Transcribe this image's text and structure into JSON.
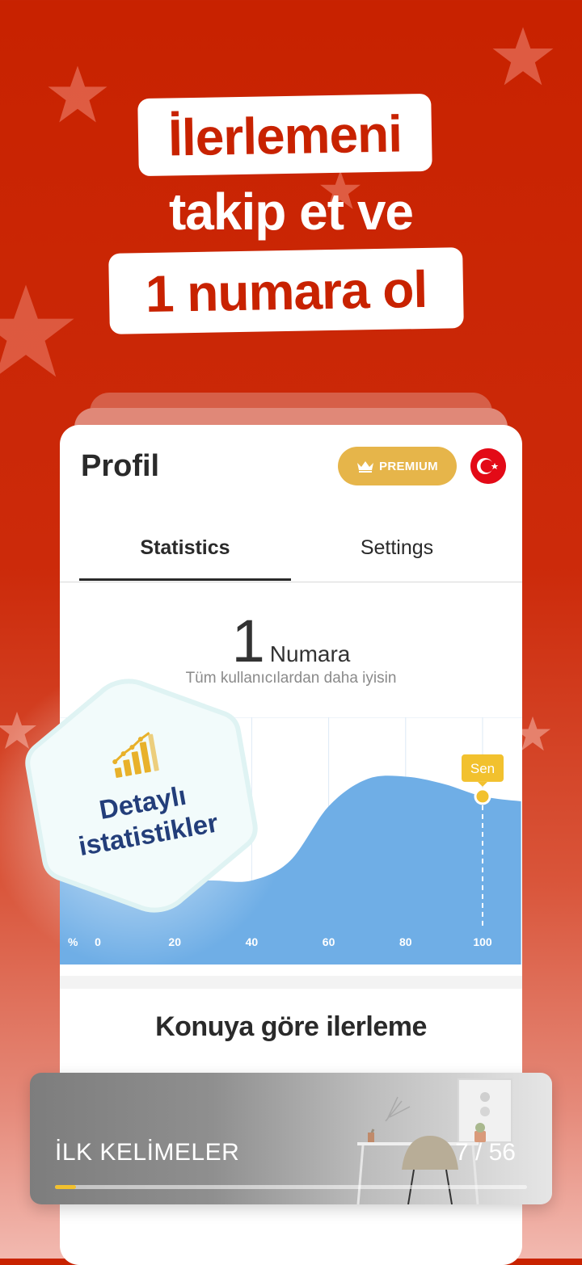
{
  "headline": {
    "line1": "İlerlemeni",
    "line2": "takip et ve",
    "line3": "1 numara ol"
  },
  "profile": {
    "title": "Profil",
    "premium_label": "PREMIUM",
    "flag_icon": "turkey-flag-icon"
  },
  "tabs": [
    {
      "label": "Statistics",
      "active": true
    },
    {
      "label": "Settings",
      "active": false
    }
  ],
  "rank": {
    "number": "1",
    "label": "Numara",
    "subtitle": "Tüm kullanıcılardan daha iyisin"
  },
  "chart_data": {
    "type": "area",
    "x_axis_unit": "%",
    "x_ticks": [
      "0",
      "20",
      "40",
      "60",
      "80",
      "100"
    ],
    "xlim": [
      0,
      110
    ],
    "x": [
      -10,
      0,
      10,
      20,
      30,
      40,
      50,
      60,
      70,
      80,
      90,
      100,
      110
    ],
    "y": [
      34,
      34,
      34,
      34,
      34,
      34,
      42,
      64,
      75,
      76,
      73,
      68,
      66
    ],
    "ylim": [
      0,
      100
    ],
    "marker": {
      "x": 100,
      "label": "Sen"
    },
    "fill_color": "#6faee6",
    "grid": true
  },
  "badge": {
    "line1": "Detaylı",
    "line2": "istatistikler",
    "icon": "chart-growth-icon"
  },
  "section": {
    "title": "Konuya göre ilerleme"
  },
  "topic_banner": {
    "title": "İLK KELİMELER",
    "count": "7 / 56",
    "progress": 0.045
  },
  "colors": {
    "background": "#c82200",
    "accent_red": "#c82200",
    "premium_gold": "#e6b54a",
    "chart_blue": "#6faee6",
    "badge_text": "#233e7a"
  }
}
